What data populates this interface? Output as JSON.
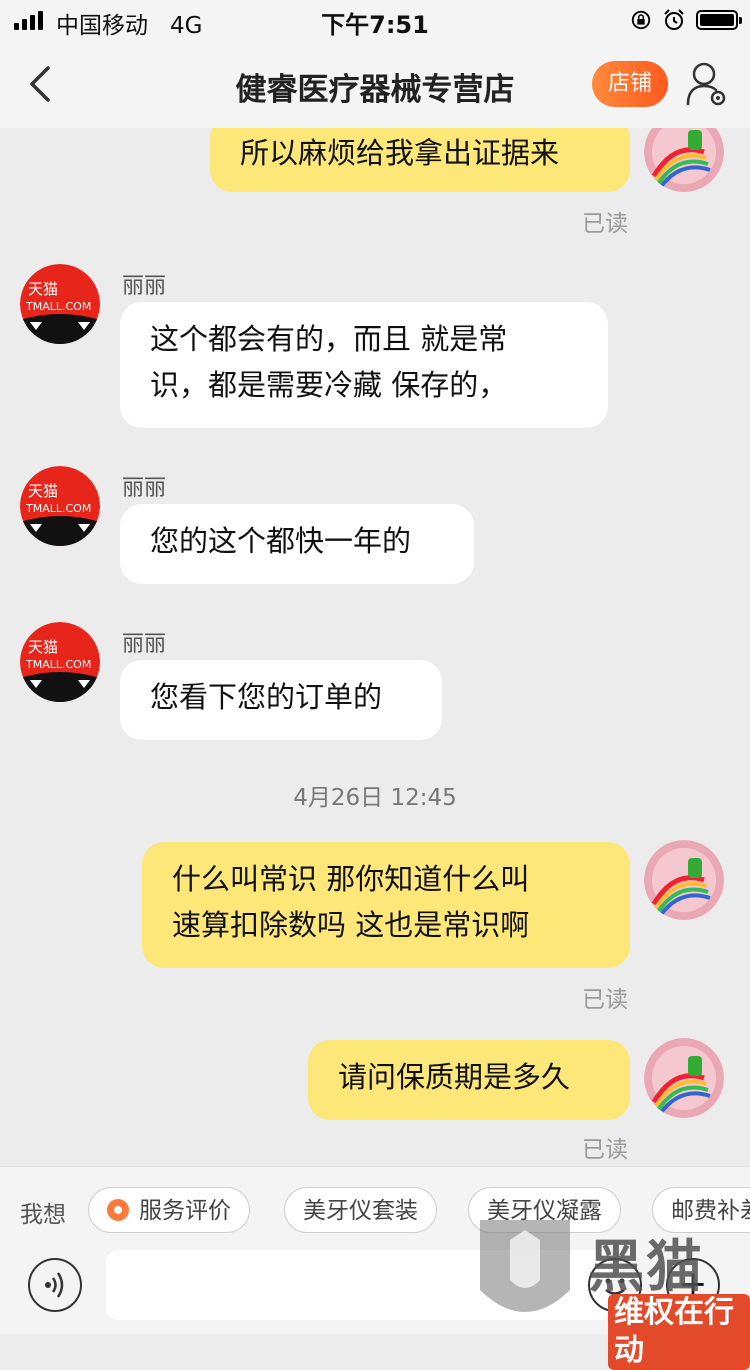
{
  "status_bar": {
    "carrier": "中国移动",
    "network": "4G",
    "time": "下午7:51"
  },
  "header": {
    "title": "健睿医疗器械专营店",
    "shop_button": "店铺",
    "back_icon": "chevron-left-icon",
    "profile_icon": "user-settings-icon"
  },
  "colors": {
    "my_bubble": "#fde779",
    "their_bubble": "#ffffff",
    "accent": "#ff6a2a",
    "background": "#ececec"
  },
  "messages": [
    {
      "from": "me",
      "lines": [
        "所以麻烦给我拿出证据来"
      ],
      "status": "已读"
    },
    {
      "from": "other",
      "sender": "丽丽",
      "avatar_text": "天猫\nTMALL.COM",
      "lines": [
        "这个都会有的，而且 就是常",
        "识，都是需要冷藏 保存的，"
      ]
    },
    {
      "from": "other",
      "sender": "丽丽",
      "avatar_text": "天猫\nTMALL.COM",
      "lines": [
        "您的这个都快一年的"
      ]
    },
    {
      "from": "other",
      "sender": "丽丽",
      "avatar_text": "天猫\nTMALL.COM",
      "lines": [
        "您看下您的订单的"
      ]
    },
    {
      "type": "timestamp",
      "text": "4月26日 12:45"
    },
    {
      "from": "me",
      "lines": [
        "什么叫常识 那你知道什么叫",
        "速算扣除数吗 这也是常识啊"
      ],
      "status": "已读"
    },
    {
      "from": "me",
      "lines": [
        "请问保质期是多久"
      ],
      "status": "已读"
    }
  ],
  "quick_replies": {
    "label": "我想",
    "chips": [
      "服务评价",
      "美牙仪套装",
      "美牙仪凝露",
      "邮费补差"
    ]
  },
  "input_bar": {
    "placeholder": "",
    "voice_icon": "voice-icon",
    "emoji_icon": "emoji-icon",
    "plus_icon": "plus-icon"
  },
  "watermark": {
    "brand": "黑猫",
    "sub": "维权在行动"
  }
}
